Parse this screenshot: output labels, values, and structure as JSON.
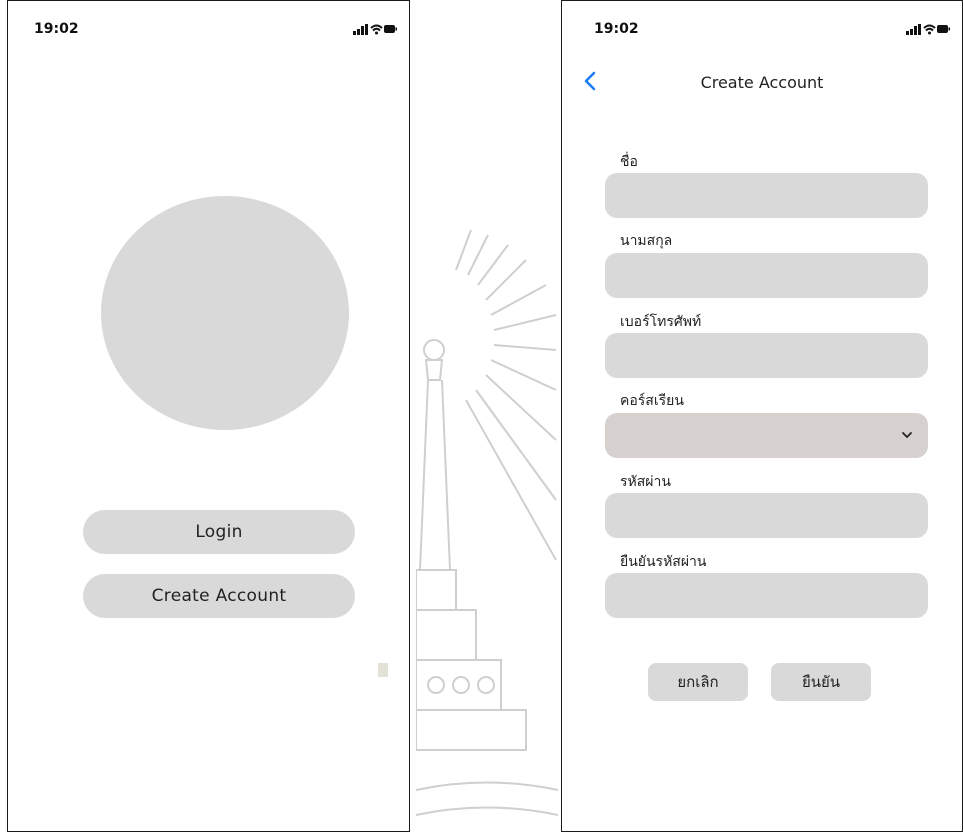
{
  "left_screen": {
    "status_time": "19:02",
    "login_label": "Login",
    "create_account_label": "Create Account"
  },
  "right_screen": {
    "status_time": "19:02",
    "title": "Create Account",
    "fields": [
      {
        "label": "ชื่อ",
        "value": ""
      },
      {
        "label": "นามสกุล",
        "value": ""
      },
      {
        "label": "เบอร์โทรศัพท์",
        "value": ""
      },
      {
        "label": "คอร์สเรียน",
        "value": ""
      },
      {
        "label": "รหัสผ่าน",
        "value": ""
      },
      {
        "label": "ยืนยันรหัสผ่าน",
        "value": ""
      }
    ],
    "cancel_label": "ยกเลิก",
    "confirm_label": "ยืนยัน"
  },
  "icons": [
    "signal-icon",
    "wifi-icon",
    "battery-icon",
    "back-chevron-icon",
    "chevron-down-icon"
  ],
  "colors": {
    "placeholder_gray": "#d9d9d9",
    "select_gray": "#d6d1ce",
    "back_blue": "#1a7cf5",
    "emblem_gray": "#cfcfcf"
  }
}
